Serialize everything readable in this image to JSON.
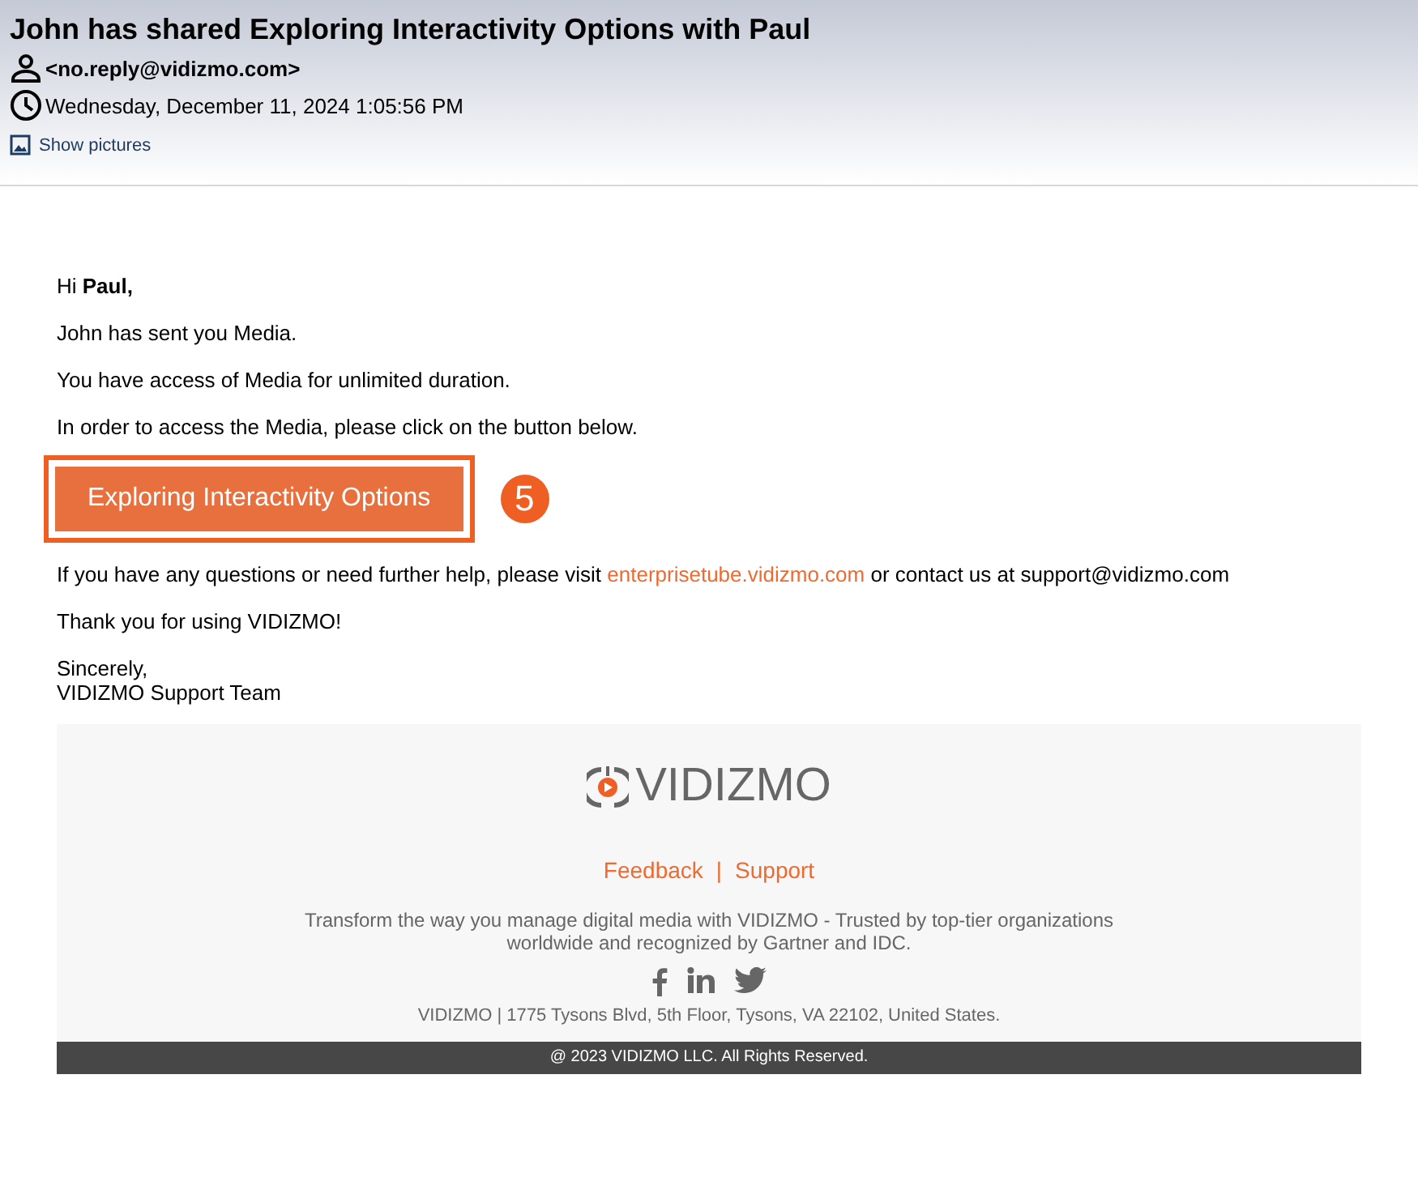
{
  "header": {
    "subject": "John has shared Exploring Interactivity Options with Paul",
    "sender": "<no.reply@vidizmo.com>",
    "date": "Wednesday, December 11, 2024 1:05:56 PM",
    "show_pictures": "Show pictures"
  },
  "body": {
    "paragraphs": [
      "Hi **Paul,**",
      "John has sent you Media.",
      "You have access of Media for unlimited duration.",
      "In order to access the Media, please click on the button below."
    ],
    "button": {
      "label": "Exploring Interactivity Options",
      "highlighted": true
    },
    "callout": "5",
    "help": {
      "before": "If you have any questions or need further help, please visit",
      "link": "enterprisetube.vidizmo.com",
      "after": "or contact us at support@vidizmo.com"
    },
    "thanks": "Thank you for using VIDIZMO!",
    "signoff": [
      "Sincerely,",
      "VIDIZMO Support Team"
    ]
  },
  "footer": {
    "logo_text": "VIDIZMO",
    "links": [
      "Feedback",
      "Support"
    ],
    "separator": "|",
    "tagline": "Transform the way you manage digital media with VIDIZMO - Trusted by top-tier organizations worldwide and recognized by Gartner and IDC.",
    "address": "VIDIZMO | 1775 Tysons Blvd, 5th Floor, Tysons, VA 22102, United States.",
    "copyright": "@ 2023 VIDIZMO LLC. All Rights Reserved."
  }
}
